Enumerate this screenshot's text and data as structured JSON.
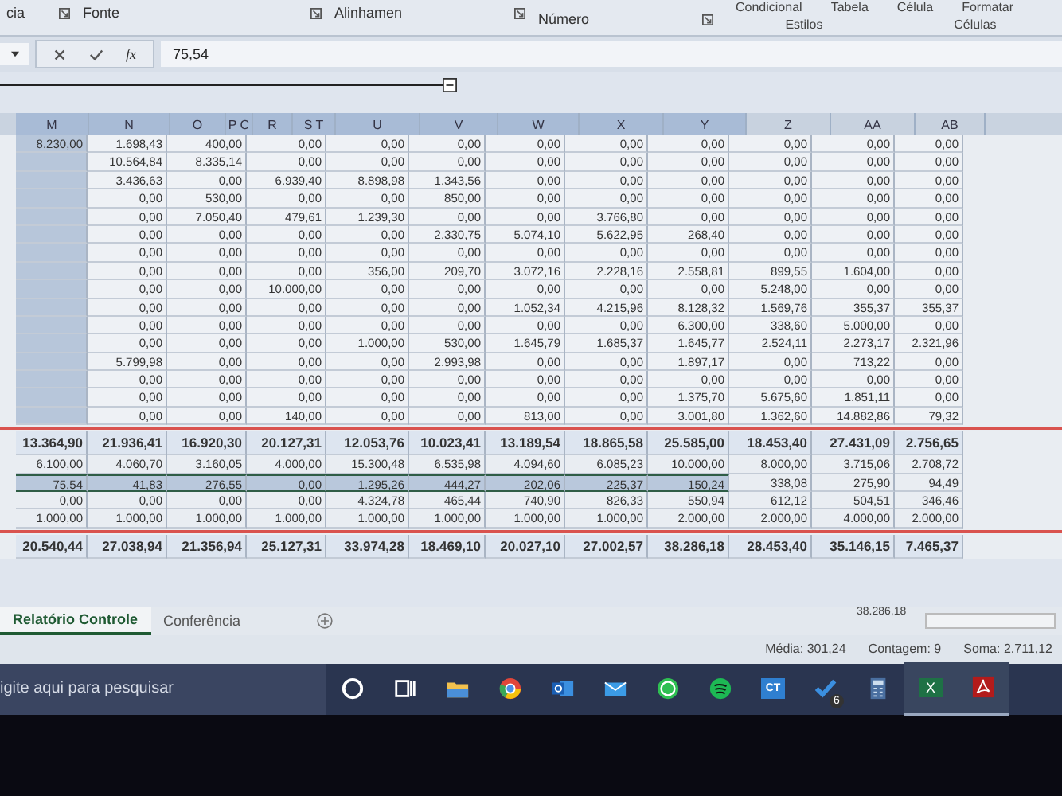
{
  "ribbon": {
    "groups": [
      "cia",
      "Fonte",
      "Alinhamen",
      "Número"
    ],
    "style_buttons": [
      "Condicional",
      "Tabela",
      "Célula",
      "Formatar"
    ],
    "group_labels": [
      "Estilos",
      "Células"
    ]
  },
  "formula_bar": {
    "fx": "fx",
    "value": "75,54"
  },
  "headers": [
    {
      "label": "M",
      "selected": true
    },
    {
      "label": "N",
      "selected": true
    },
    {
      "label": "O",
      "selected": true
    },
    {
      "label": "P C",
      "selected": true
    },
    {
      "label": "R",
      "selected": true
    },
    {
      "label": "S T",
      "selected": true
    },
    {
      "label": "U",
      "selected": true
    },
    {
      "label": "V",
      "selected": true
    },
    {
      "label": "W",
      "selected": true
    },
    {
      "label": "X",
      "selected": true
    },
    {
      "label": "Y",
      "selected": true
    },
    {
      "label": "Z",
      "selected": false
    },
    {
      "label": "AA",
      "selected": false
    },
    {
      "label": "AB",
      "selected": false
    }
  ],
  "rows": [
    [
      "8.230,00",
      "1.698,43",
      "400,00",
      "0,00",
      "0,00",
      "0,00",
      "0,00",
      "0,00",
      "0,00",
      "0,00",
      "0,00",
      "0,00"
    ],
    [
      "",
      "10.564,84",
      "8.335,14",
      "0,00",
      "0,00",
      "0,00",
      "0,00",
      "0,00",
      "0,00",
      "0,00",
      "0,00",
      "0,00"
    ],
    [
      "",
      "3.436,63",
      "0,00",
      "6.939,40",
      "8.898,98",
      "1.343,56",
      "0,00",
      "0,00",
      "0,00",
      "0,00",
      "0,00",
      "0,00"
    ],
    [
      "",
      "0,00",
      "530,00",
      "0,00",
      "0,00",
      "850,00",
      "0,00",
      "0,00",
      "0,00",
      "0,00",
      "0,00",
      "0,00"
    ],
    [
      "",
      "0,00",
      "7.050,40",
      "479,61",
      "1.239,30",
      "0,00",
      "0,00",
      "3.766,80",
      "0,00",
      "0,00",
      "0,00",
      "0,00"
    ],
    [
      "",
      "0,00",
      "0,00",
      "0,00",
      "0,00",
      "2.330,75",
      "5.074,10",
      "5.622,95",
      "268,40",
      "0,00",
      "0,00",
      "0,00"
    ],
    [
      "",
      "0,00",
      "0,00",
      "0,00",
      "0,00",
      "0,00",
      "0,00",
      "0,00",
      "0,00",
      "0,00",
      "0,00",
      "0,00"
    ],
    [
      "",
      "0,00",
      "0,00",
      "0,00",
      "356,00",
      "209,70",
      "3.072,16",
      "2.228,16",
      "2.558,81",
      "899,55",
      "1.604,00",
      "0,00"
    ],
    [
      "",
      "0,00",
      "0,00",
      "10.000,00",
      "0,00",
      "0,00",
      "0,00",
      "0,00",
      "0,00",
      "5.248,00",
      "0,00",
      "0,00"
    ],
    [
      "",
      "0,00",
      "0,00",
      "0,00",
      "0,00",
      "0,00",
      "1.052,34",
      "4.215,96",
      "8.128,32",
      "1.569,76",
      "355,37",
      "355,37"
    ],
    [
      "",
      "0,00",
      "0,00",
      "0,00",
      "0,00",
      "0,00",
      "0,00",
      "0,00",
      "6.300,00",
      "338,60",
      "5.000,00",
      "0,00"
    ],
    [
      "",
      "0,00",
      "0,00",
      "0,00",
      "1.000,00",
      "530,00",
      "1.645,79",
      "1.685,37",
      "1.645,77",
      "2.524,11",
      "2.273,17",
      "2.321,96"
    ],
    [
      "",
      "5.799,98",
      "0,00",
      "0,00",
      "0,00",
      "2.993,98",
      "0,00",
      "0,00",
      "1.897,17",
      "0,00",
      "713,22",
      "0,00"
    ],
    [
      "",
      "0,00",
      "0,00",
      "0,00",
      "0,00",
      "0,00",
      "0,00",
      "0,00",
      "0,00",
      "0,00",
      "0,00",
      "0,00"
    ],
    [
      "",
      "0,00",
      "0,00",
      "0,00",
      "0,00",
      "0,00",
      "0,00",
      "0,00",
      "1.375,70",
      "5.675,60",
      "1.851,11",
      "0,00"
    ],
    [
      "",
      "0,00",
      "0,00",
      "140,00",
      "0,00",
      "0,00",
      "813,00",
      "0,00",
      "3.001,80",
      "1.362,60",
      "14.882,86",
      "79,32"
    ]
  ],
  "summary": [
    {
      "kind": "total",
      "cells": [
        {
          "text": "13.364,90",
          "selected": false
        },
        {
          "text": "21.936,41",
          "selected": false
        },
        {
          "text": "16.920,30",
          "selected": false
        },
        {
          "text": "20.127,31",
          "selected": false
        },
        {
          "text": "12.053,76",
          "selected": false
        },
        {
          "text": "10.023,41",
          "selected": false
        },
        {
          "text": "13.189,54",
          "selected": false
        },
        {
          "text": "18.865,58",
          "selected": false
        },
        {
          "text": "25.585,00",
          "selected": false
        },
        {
          "text": "18.453,40",
          "selected": false
        },
        {
          "text": "27.431,09",
          "selected": false
        },
        {
          "text": "2.756,65",
          "selected": false
        }
      ]
    },
    {
      "kind": "sub",
      "cells": [
        {
          "text": "6.100,00",
          "selected": false
        },
        {
          "text": "4.060,70",
          "selected": false
        },
        {
          "text": "3.160,05",
          "selected": false
        },
        {
          "text": "4.000,00",
          "selected": false
        },
        {
          "text": "15.300,48",
          "selected": false
        },
        {
          "text": "6.535,98",
          "selected": false
        },
        {
          "text": "4.094,60",
          "selected": false
        },
        {
          "text": "6.085,23",
          "selected": false
        },
        {
          "text": "10.000,00",
          "selected": false
        },
        {
          "text": "8.000,00",
          "selected": false
        },
        {
          "text": "3.715,06",
          "selected": false
        },
        {
          "text": "2.708,72",
          "selected": false
        }
      ]
    },
    {
      "kind": "sub",
      "cells": [
        {
          "text": "75,54",
          "selected": true
        },
        {
          "text": "41,83",
          "selected": true
        },
        {
          "text": "276,55",
          "selected": true
        },
        {
          "text": "0,00",
          "selected": true
        },
        {
          "text": "1.295,26",
          "selected": true
        },
        {
          "text": "444,27",
          "selected": true
        },
        {
          "text": "202,06",
          "selected": true
        },
        {
          "text": "225,37",
          "selected": true
        },
        {
          "text": "150,24",
          "selected": true
        },
        {
          "text": "338,08",
          "selected": false
        },
        {
          "text": "275,90",
          "selected": false
        },
        {
          "text": "94,49",
          "selected": false
        }
      ]
    },
    {
      "kind": "sub",
      "cells": [
        {
          "text": "0,00",
          "selected": false
        },
        {
          "text": "0,00",
          "selected": false
        },
        {
          "text": "0,00",
          "selected": false
        },
        {
          "text": "0,00",
          "selected": false
        },
        {
          "text": "4.324,78",
          "selected": false
        },
        {
          "text": "465,44",
          "selected": false
        },
        {
          "text": "740,90",
          "selected": false
        },
        {
          "text": "826,33",
          "selected": false
        },
        {
          "text": "550,94",
          "selected": false
        },
        {
          "text": "612,12",
          "selected": false
        },
        {
          "text": "504,51",
          "selected": false
        },
        {
          "text": "346,46",
          "selected": false
        }
      ]
    },
    {
      "kind": "sub",
      "cells": [
        {
          "text": "1.000,00",
          "selected": false
        },
        {
          "text": "1.000,00",
          "selected": false
        },
        {
          "text": "1.000,00",
          "selected": false
        },
        {
          "text": "1.000,00",
          "selected": false
        },
        {
          "text": "1.000,00",
          "selected": false
        },
        {
          "text": "1.000,00",
          "selected": false
        },
        {
          "text": "1.000,00",
          "selected": false
        },
        {
          "text": "1.000,00",
          "selected": false
        },
        {
          "text": "2.000,00",
          "selected": false
        },
        {
          "text": "2.000,00",
          "selected": false
        },
        {
          "text": "4.000,00",
          "selected": false
        },
        {
          "text": "2.000,00",
          "selected": false
        }
      ]
    },
    {
      "kind": "total",
      "cells": [
        {
          "text": "20.540,44",
          "selected": false
        },
        {
          "text": "27.038,94",
          "selected": false
        },
        {
          "text": "21.356,94",
          "selected": false
        },
        {
          "text": "25.127,31",
          "selected": false
        },
        {
          "text": "33.974,28",
          "selected": false
        },
        {
          "text": "18.469,10",
          "selected": false
        },
        {
          "text": "20.027,10",
          "selected": false
        },
        {
          "text": "27.002,57",
          "selected": false
        },
        {
          "text": "38.286,18",
          "selected": false
        },
        {
          "text": "28.453,40",
          "selected": false
        },
        {
          "text": "35.146,15",
          "selected": false
        },
        {
          "text": "7.465,37",
          "selected": false
        }
      ]
    }
  ],
  "sheet_tabs": [
    {
      "label": "Relatório Controle",
      "selected": true
    },
    {
      "label": "Conferência",
      "selected": false
    }
  ],
  "scroll_tip": "38.286,18",
  "status_bar": [
    "Média: 301,24",
    "Contagem: 9",
    "Soma: 2.711,12"
  ],
  "taskbar": {
    "search_placeholder": "igite aqui para pesquisar",
    "apps": [
      {
        "kind": "cortana",
        "active": false
      },
      {
        "kind": "taskview",
        "active": false
      },
      {
        "kind": "folder",
        "active": false
      },
      {
        "kind": "browser",
        "active": false
      },
      {
        "kind": "outlook",
        "active": false
      },
      {
        "kind": "mail",
        "active": false
      },
      {
        "kind": "chat",
        "active": false
      },
      {
        "kind": "music",
        "active": false
      },
      {
        "kind": "ct",
        "label": "CT",
        "active": false
      },
      {
        "kind": "todo",
        "badge": "6",
        "active": false
      },
      {
        "kind": "calc",
        "active": false
      },
      {
        "kind": "excel",
        "label": "X",
        "active": true
      },
      {
        "kind": "pdf",
        "active": true
      }
    ]
  }
}
